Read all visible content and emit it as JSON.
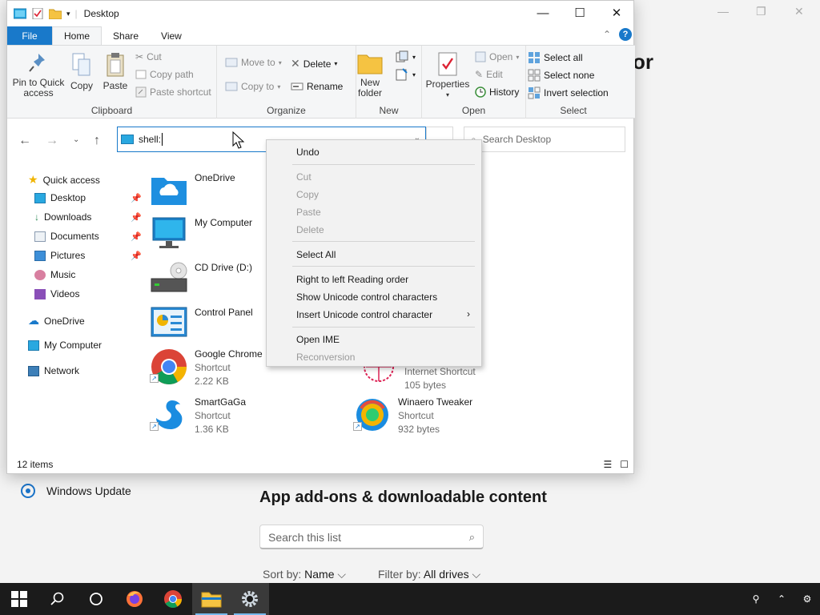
{
  "explorer": {
    "title": "Desktop",
    "tabs": [
      "File",
      "Home",
      "Share",
      "View"
    ],
    "ribbon": {
      "clipboard": {
        "label": "Clipboard",
        "pin_to_quick_access": "Pin to Quick access",
        "copy": "Copy",
        "paste": "Paste",
        "cut": "Cut",
        "copy_path": "Copy path",
        "paste_shortcut": "Paste shortcut"
      },
      "organize": {
        "label": "Organize",
        "move_to": "Move to",
        "copy_to": "Copy to",
        "delete": "Delete",
        "rename": "Rename"
      },
      "new": {
        "label": "New",
        "new_folder": "New folder"
      },
      "open": {
        "label": "Open",
        "properties": "Properties",
        "open": "Open",
        "edit": "Edit",
        "history": "History"
      },
      "select": {
        "label": "Select",
        "select_all": "Select all",
        "select_none": "Select none",
        "invert_selection": "Invert selection"
      }
    },
    "address": {
      "value": "shell:"
    },
    "search": {
      "placeholder": "Search Desktop"
    },
    "nav_pane": {
      "quick_access": "Quick access",
      "desktop": "Desktop",
      "downloads": "Downloads",
      "documents": "Documents",
      "pictures": "Pictures",
      "music": "Music",
      "videos": "Videos",
      "onedrive": "OneDrive",
      "my_computer": "My Computer",
      "network": "Network"
    },
    "files": [
      {
        "name": "OneDrive"
      },
      {
        "name": "My Computer"
      },
      {
        "name": "CD Drive (D:)"
      },
      {
        "name": "Control Panel"
      },
      {
        "name": "Google Chrome",
        "type": "Shortcut",
        "size": "2.22 KB"
      },
      {
        "name": "SmartGaGa",
        "type": "Shortcut",
        "size": "1.36 KB"
      },
      {
        "type": "Internet Shortcut",
        "size": "105 bytes"
      },
      {
        "name": "Winaero Tweaker",
        "type": "Shortcut",
        "size": "932 bytes"
      }
    ],
    "status": "12 items"
  },
  "context_menu": {
    "undo": "Undo",
    "cut": "Cut",
    "copy": "Copy",
    "paste": "Paste",
    "delete": "Delete",
    "select_all": "Select All",
    "rtl": "Right to left Reading order",
    "show_unicode": "Show Unicode control characters",
    "insert_unicode": "Insert Unicode control character",
    "open_ime": "Open IME",
    "reconversion": "Reconversion"
  },
  "background": {
    "partial_title": "or",
    "windows_update": "Windows Update",
    "heading": "App add-ons & downloadable content",
    "search_placeholder": "Search this list",
    "sort_label": "Sort by:",
    "sort_value": "Name",
    "filter_label": "Filter by:",
    "filter_value": "All drives"
  },
  "colors": {
    "accent": "#1979ca",
    "taskbar": "#1b1b1b"
  }
}
